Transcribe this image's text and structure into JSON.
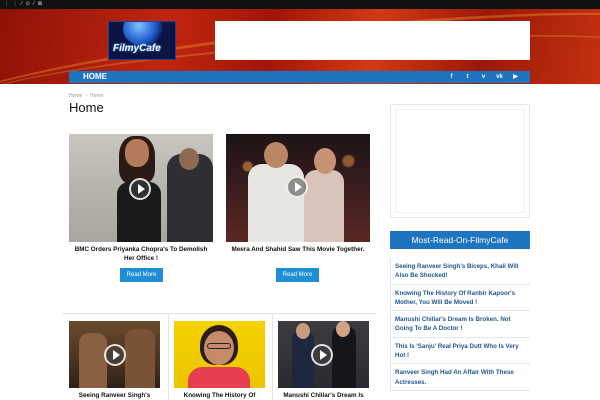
{
  "topbar": {
    "glyphs": "⋮ ⋮ ⁄ ⊙ ⁄ ⊠"
  },
  "brand": {
    "logo_text": "FilmyCafe"
  },
  "nav": {
    "home_label": "HOME",
    "social": [
      {
        "icon": "facebook-icon",
        "glyph": "f"
      },
      {
        "icon": "twitter-icon",
        "glyph": "t"
      },
      {
        "icon": "vimeo-icon",
        "glyph": "v"
      },
      {
        "icon": "vk-icon",
        "glyph": "vk"
      },
      {
        "icon": "youtube-icon",
        "glyph": "▶"
      }
    ]
  },
  "breadcrumb": {
    "root": "Home",
    "separator": "›",
    "current": "Home"
  },
  "page": {
    "title": "Home"
  },
  "featured": [
    {
      "caption": "BMC Orders Priyanka Chopra's To Demolish Her Office !",
      "button": "Read More"
    },
    {
      "caption": "Meera And Shahid Saw This Movie Together.",
      "button": "Read More"
    }
  ],
  "grid": [
    {
      "caption": "Seeing Ranveer Singh's"
    },
    {
      "caption": "Knowing The History Of"
    },
    {
      "caption": "Manushi Chillar's Dream Is"
    }
  ],
  "sidebar": {
    "widget_title": "Most-Read-On-FilmyCafe",
    "items": [
      "Seeing Ranveer Singh's Biceps, Khali Will Also Be Shocked!",
      "Knowing The History Of Ranbir Kapoor's Mother, You Will Be  Moved !",
      "Manushi Chillar's Dream Is Broken. Not Going  To Be  A Doctor !",
      "This Is 'Sanju' Real Priya Dutt Who Is Very Hot !",
      "Ranveer Singh Had An Affair With These Actresses."
    ]
  },
  "colors": {
    "nav_blue": "#1f74c0",
    "button_blue": "#1e8fd6",
    "link_blue": "#20588f",
    "banner_red": "#c0260f"
  }
}
